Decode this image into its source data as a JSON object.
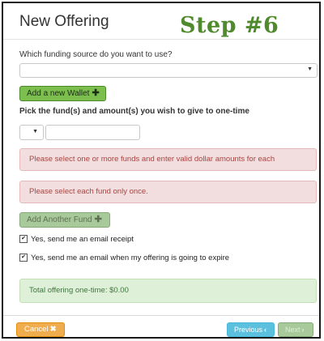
{
  "header": {
    "title": "New Offering",
    "step_label": "Step #6"
  },
  "funding": {
    "question": "Which funding source do you want to use?",
    "selected_value": "",
    "add_wallet_label": "Add a new Wallet",
    "add_wallet_icon": "plus-icon"
  },
  "funds": {
    "prompt": "Pick the fund(s) and amount(s) you wish to give to one-time",
    "fund_selected": "",
    "amount_value": "",
    "error_select_funds": "Please select one or more funds and enter valid dollar amounts for each",
    "error_fund_once": "Please select each fund only once.",
    "add_another_label": "Add Another Fund",
    "add_another_icon": "plus-icon"
  },
  "options": {
    "email_receipt_label": "Yes, send me an email receipt",
    "email_receipt_checked": true,
    "email_expire_label": "Yes, send me an email when my offering is going to expire",
    "email_expire_checked": true
  },
  "summary": {
    "total_label": "Total offering one-time: $0.00"
  },
  "footer": {
    "cancel_label": "Cancel",
    "cancel_icon": "close-icon",
    "previous_label": "Previous",
    "previous_icon": "chevron-left-icon",
    "next_label": "Next",
    "next_icon": "chevron-right-icon"
  },
  "colors": {
    "step_text": "#4f8a2c",
    "danger_bg": "#f2dede",
    "success_bg": "#dff0d8",
    "cancel_bg": "#f0ad4e",
    "previous_bg": "#5bc0de"
  }
}
